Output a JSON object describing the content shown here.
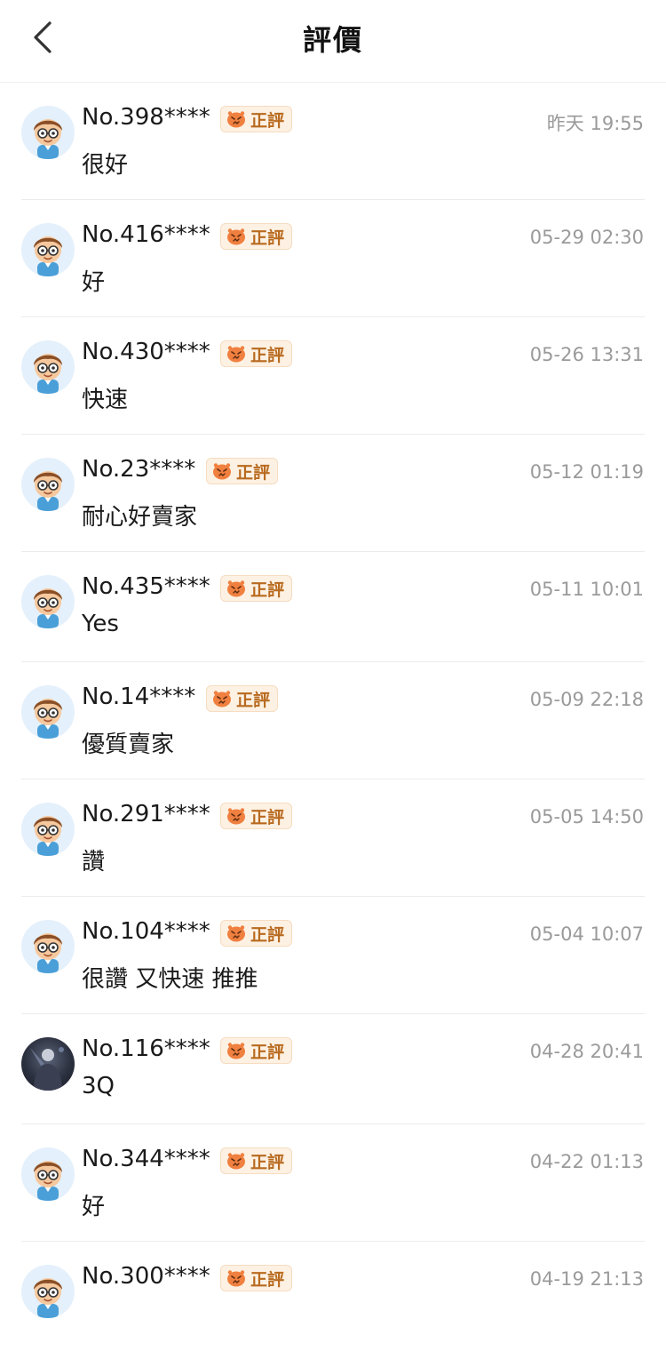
{
  "header": {
    "title": "評價",
    "back_icon": "chevron-left-icon"
  },
  "badge_icon": "angry-face-icon",
  "colors": {
    "badge_bg": "#fdf1e3",
    "badge_text": "#b86a1f",
    "timestamp": "#9a9a9a"
  },
  "reviews": [
    {
      "user": "No.398****",
      "badge": "正評",
      "time": "昨天 19:55",
      "comment": "很好",
      "avatar": "cartoon-boy-avatar"
    },
    {
      "user": "No.416****",
      "badge": "正評",
      "time": "05-29 02:30",
      "comment": "好",
      "avatar": "cartoon-boy-avatar"
    },
    {
      "user": "No.430****",
      "badge": "正評",
      "time": "05-26 13:31",
      "comment": "快速",
      "avatar": "cartoon-boy-avatar"
    },
    {
      "user": "No.23****",
      "badge": "正評",
      "time": "05-12 01:19",
      "comment": "耐心好賣家",
      "avatar": "cartoon-boy-avatar"
    },
    {
      "user": "No.435****",
      "badge": "正評",
      "time": "05-11 10:01",
      "comment": "Yes",
      "avatar": "cartoon-boy-avatar"
    },
    {
      "user": "No.14****",
      "badge": "正評",
      "time": "05-09 22:18",
      "comment": "優質賣家",
      "avatar": "cartoon-boy-avatar"
    },
    {
      "user": "No.291****",
      "badge": "正評",
      "time": "05-05 14:50",
      "comment": "讚",
      "avatar": "cartoon-boy-avatar"
    },
    {
      "user": "No.104****",
      "badge": "正評",
      "time": "05-04 10:07",
      "comment": "很讚 又快速 推推",
      "avatar": "cartoon-boy-avatar"
    },
    {
      "user": "No.116****",
      "badge": "正評",
      "time": "04-28 20:41",
      "comment": "3Q",
      "avatar": "photo-avatar"
    },
    {
      "user": "No.344****",
      "badge": "正評",
      "time": "04-22 01:13",
      "comment": "好",
      "avatar": "cartoon-boy-avatar"
    },
    {
      "user": "No.300****",
      "badge": "正評",
      "time": "04-19 21:13",
      "comment": "",
      "avatar": "cartoon-boy-avatar"
    }
  ]
}
